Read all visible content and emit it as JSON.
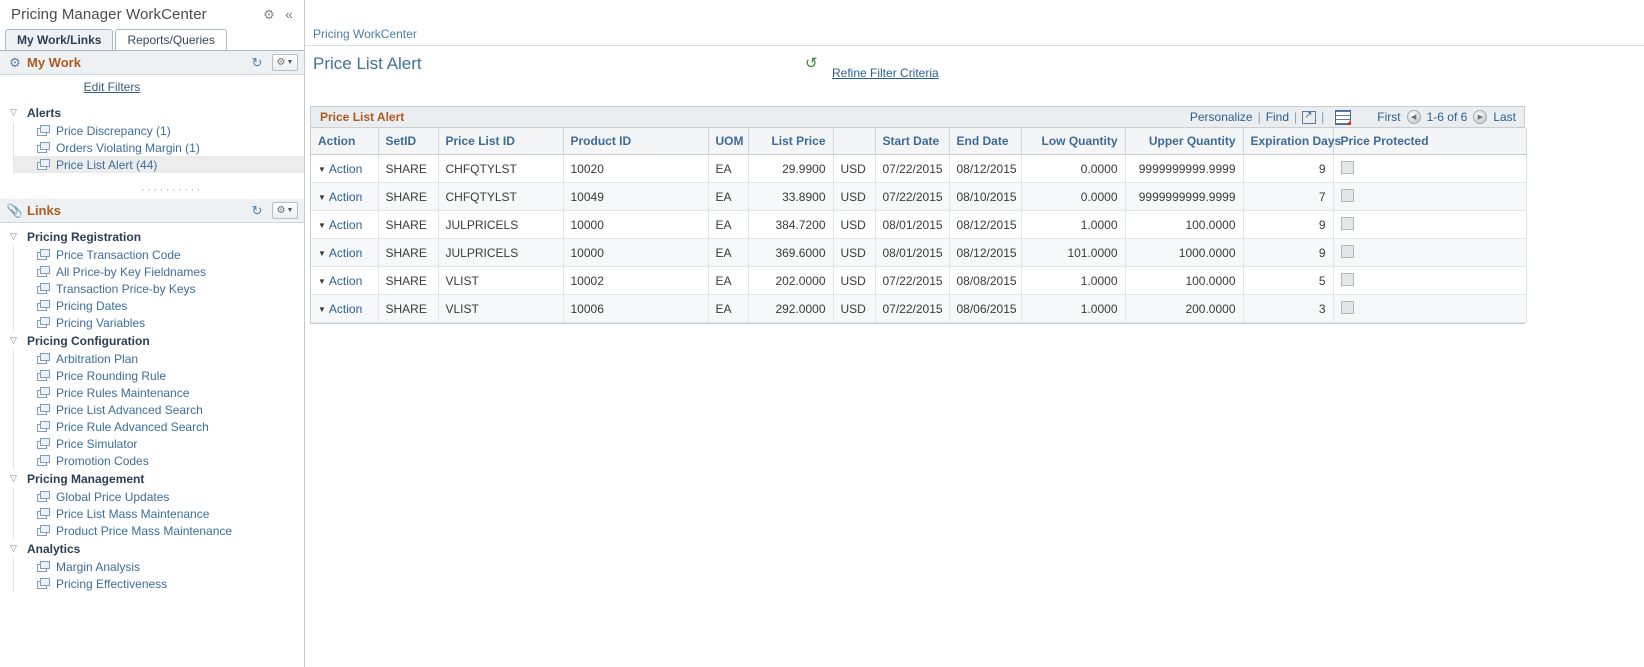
{
  "sidebar": {
    "title": "Pricing Manager WorkCenter",
    "header_icons": [
      {
        "name": "gear-icon",
        "glyph": "⚙"
      },
      {
        "name": "collapse-icon",
        "glyph": "«"
      }
    ],
    "tabs": [
      {
        "label": "My Work/Links",
        "active": true
      },
      {
        "label": "Reports/Queries",
        "active": false
      }
    ],
    "my_work": {
      "title": "My Work",
      "icon": "gears-icon",
      "refresh_icon": "refresh-icon",
      "options_icon": "gear-dropdown-icon",
      "edit_filters_label": "Edit Filters",
      "groups": [
        {
          "label": "Alerts",
          "items": [
            {
              "label": "Price Discrepancy (1)",
              "selected": false
            },
            {
              "label": "Orders Violating Margin (1)",
              "selected": false
            },
            {
              "label": "Price List Alert (44)",
              "selected": true
            }
          ]
        }
      ]
    },
    "links": {
      "title": "Links",
      "icon": "paperclip-icon",
      "refresh_icon": "refresh-icon",
      "options_icon": "gear-dropdown-icon",
      "groups": [
        {
          "label": "Pricing Registration",
          "items": [
            {
              "label": "Price Transaction Code"
            },
            {
              "label": "All Price-by Key Fieldnames"
            },
            {
              "label": "Transaction Price-by Keys"
            },
            {
              "label": "Pricing Dates"
            },
            {
              "label": "Pricing Variables"
            }
          ]
        },
        {
          "label": "Pricing Configuration",
          "items": [
            {
              "label": "Arbitration Plan"
            },
            {
              "label": "Price Rounding Rule"
            },
            {
              "label": "Price Rules Maintenance"
            },
            {
              "label": "Price List Advanced Search"
            },
            {
              "label": "Price Rule Advanced Search"
            },
            {
              "label": "Price Simulator"
            },
            {
              "label": "Promotion Codes"
            }
          ]
        },
        {
          "label": "Pricing Management",
          "items": [
            {
              "label": "Global Price Updates"
            },
            {
              "label": "Price List Mass Maintenance"
            },
            {
              "label": "Product Price Mass Maintenance"
            }
          ]
        },
        {
          "label": "Analytics",
          "items": [
            {
              "label": "Margin Analysis"
            },
            {
              "label": "Pricing Effectiveness"
            }
          ]
        }
      ]
    }
  },
  "main": {
    "breadcrumb": "Pricing WorkCenter",
    "page_title": "Price List Alert",
    "refresh_icon": "refresh-green-icon",
    "refine_filter_label": "Refine Filter Criteria",
    "grid": {
      "title": "Price List Alert",
      "personalize_label": "Personalize",
      "find_label": "Find",
      "expand_icon": "view-all-icon",
      "download_icon": "download-grid-icon",
      "first_label": "First",
      "prev_icon": "previous-page-icon",
      "range_label": "1-6 of 6",
      "next_icon": "next-page-icon",
      "last_label": "Last",
      "columns": [
        {
          "label": "Action",
          "align": "left"
        },
        {
          "label": "SetID",
          "align": "left"
        },
        {
          "label": "Price List ID",
          "align": "left"
        },
        {
          "label": "Product ID",
          "align": "left"
        },
        {
          "label": "UOM",
          "align": "left"
        },
        {
          "label": "List Price",
          "align": "right"
        },
        {
          "label": "",
          "align": "left"
        },
        {
          "label": "Start Date",
          "align": "left"
        },
        {
          "label": "End Date",
          "align": "left"
        },
        {
          "label": "Low Quantity",
          "align": "right"
        },
        {
          "label": "Upper Quantity",
          "align": "right"
        },
        {
          "label": "Expiration Days",
          "align": "right"
        },
        {
          "label": "Price Protected",
          "align": "left"
        }
      ],
      "action_label": "Action",
      "rows": [
        {
          "action": "Action",
          "setid": "SHARE",
          "price_list_id": "CHFQTYLST",
          "product_id": "10020",
          "uom": "EA",
          "list_price": "29.9900",
          "currency": "USD",
          "start_date": "07/22/2015",
          "end_date": "08/12/2015",
          "low_quantity": "0.0000",
          "upper_quantity": "9999999999.9999",
          "expiration_days": "9",
          "price_protected": false
        },
        {
          "action": "Action",
          "setid": "SHARE",
          "price_list_id": "CHFQTYLST",
          "product_id": "10049",
          "uom": "EA",
          "list_price": "33.8900",
          "currency": "USD",
          "start_date": "07/22/2015",
          "end_date": "08/10/2015",
          "low_quantity": "0.0000",
          "upper_quantity": "9999999999.9999",
          "expiration_days": "7",
          "price_protected": false
        },
        {
          "action": "Action",
          "setid": "SHARE",
          "price_list_id": "JULPRICELS",
          "product_id": "10000",
          "uom": "EA",
          "list_price": "384.7200",
          "currency": "USD",
          "start_date": "08/01/2015",
          "end_date": "08/12/2015",
          "low_quantity": "1.0000",
          "upper_quantity": "100.0000",
          "expiration_days": "9",
          "price_protected": false
        },
        {
          "action": "Action",
          "setid": "SHARE",
          "price_list_id": "JULPRICELS",
          "product_id": "10000",
          "uom": "EA",
          "list_price": "369.6000",
          "currency": "USD",
          "start_date": "08/01/2015",
          "end_date": "08/12/2015",
          "low_quantity": "101.0000",
          "upper_quantity": "1000.0000",
          "expiration_days": "9",
          "price_protected": false
        },
        {
          "action": "Action",
          "setid": "SHARE",
          "price_list_id": "VLIST",
          "product_id": "10002",
          "uom": "EA",
          "list_price": "202.0000",
          "currency": "USD",
          "start_date": "07/22/2015",
          "end_date": "08/08/2015",
          "low_quantity": "1.0000",
          "upper_quantity": "100.0000",
          "expiration_days": "5",
          "price_protected": false
        },
        {
          "action": "Action",
          "setid": "SHARE",
          "price_list_id": "VLIST",
          "product_id": "10006",
          "uom": "EA",
          "list_price": "292.0000",
          "currency": "USD",
          "start_date": "07/22/2015",
          "end_date": "08/06/2015",
          "low_quantity": "1.0000",
          "upper_quantity": "200.0000",
          "expiration_days": "3",
          "price_protected": false
        }
      ]
    }
  },
  "colors": {
    "accent_orange": "#b05a1e",
    "link_blue": "#2b5f8f",
    "header_blue": "#3f6a96",
    "title_blue": "#41719c",
    "green": "#3a8b3a"
  }
}
